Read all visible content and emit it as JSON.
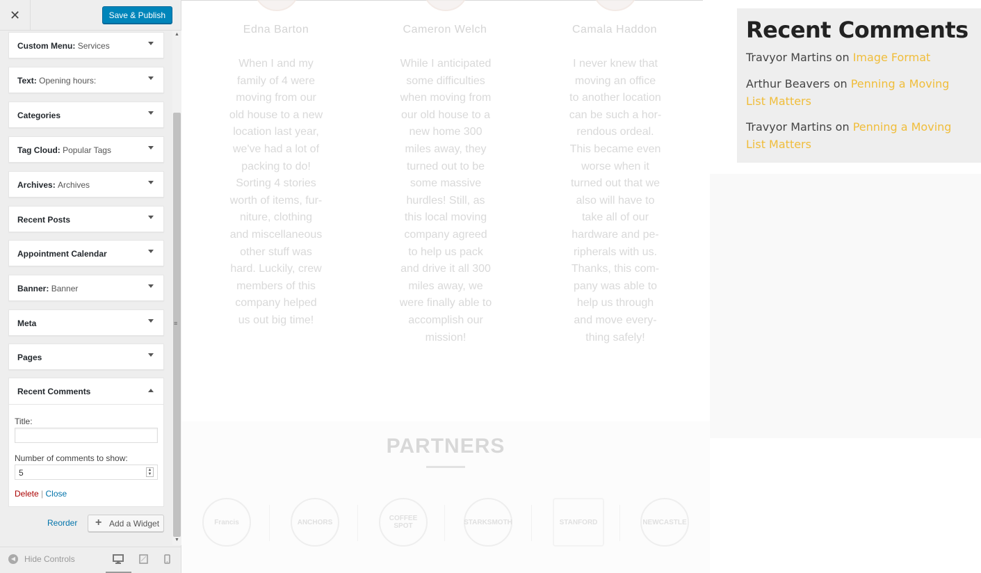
{
  "sidebar": {
    "close_label": "✕",
    "save_label": "Save & Publish",
    "widgets": [
      {
        "type": "Custom Menu",
        "subtitle": "Services"
      },
      {
        "type": "Text",
        "subtitle": "Opening hours:"
      },
      {
        "type": "Categories",
        "subtitle": ""
      },
      {
        "type": "Tag Cloud",
        "subtitle": "Popular Tags"
      },
      {
        "type": "Archives",
        "subtitle": "Archives"
      },
      {
        "type": "Recent Posts",
        "subtitle": ""
      },
      {
        "type": "Appointment Calendar",
        "subtitle": ""
      },
      {
        "type": "Banner",
        "subtitle": "Banner"
      },
      {
        "type": "Meta",
        "subtitle": ""
      },
      {
        "type": "Pages",
        "subtitle": ""
      }
    ],
    "open_widget": {
      "title": "Recent Comments",
      "title_field_label": "Title:",
      "title_field_value": "",
      "number_label": "Number of comments to show:",
      "number_value": "5",
      "delete_label": "Delete",
      "separator": "|",
      "close_label": "Close"
    },
    "reorder_label": "Reorder",
    "add_widget_label": "Add a Widget",
    "footer": {
      "hide_controls_label": "Hide Controls",
      "devices": [
        "desktop-icon",
        "tablet-icon",
        "mobile-icon"
      ],
      "active_device": "desktop"
    }
  },
  "preview": {
    "testimonials": [
      {
        "name": "Edna Barton",
        "lines": [
          "When I and my",
          "family of 4 were",
          "moving from our",
          "old house to a new",
          "location last year,",
          "we've had a lot of",
          "packing to do!",
          "Sorting 4 stories",
          "worth of items, fur-",
          "niture, clothing",
          "and miscellaneous",
          "other stuff was",
          "hard. Luckily, crew",
          "members of this",
          "company helped",
          "us out big time!"
        ]
      },
      {
        "name": "Cameron Welch",
        "lines": [
          "While I anticipated",
          "some difficulties",
          "when moving from",
          "our old house to a",
          "new home 300",
          "miles away, they",
          "turned out to be",
          "some massive",
          "hurdles! Still, as",
          "this local moving",
          "company agreed",
          "to help us pack",
          "and drive it all 300",
          "miles away, we",
          "were finally able to",
          "accomplish our",
          "mission!"
        ]
      },
      {
        "name": "Camala Haddon",
        "lines": [
          "I never knew that",
          "moving an office",
          "to another location",
          "can be such a hor-",
          "rendous ordeal.",
          "This became even",
          "worse when it",
          "turned out that we",
          "also will have to",
          "take all of our",
          "hardware and pe-",
          "ripherals with us.",
          "Thanks, this com-",
          "pany was able to",
          "help us through",
          "and move every-",
          "thing safely!"
        ]
      }
    ],
    "partners_title": "PARTNERS",
    "partner_logos": [
      "Francis",
      "ANCHORS",
      "COFFEE SPOT",
      "STARKSMOTH",
      "STANFORD",
      "NEWCASTLE"
    ],
    "recent_comments": {
      "title": "Recent Comments",
      "connector": "on",
      "items": [
        {
          "author": "Travyor Martins",
          "post_line1": "Image Format",
          "post_line2": ""
        },
        {
          "author": "Arthur Beavers",
          "post_line1": "Penning a Moving",
          "post_line2": "List Matters"
        },
        {
          "author": "Travyor Martins",
          "post_line1": "Penning a Moving",
          "post_line2": "List Matters"
        }
      ]
    },
    "colors": {
      "link": "#f0bd3a",
      "primary_button": "#0085ba"
    }
  }
}
